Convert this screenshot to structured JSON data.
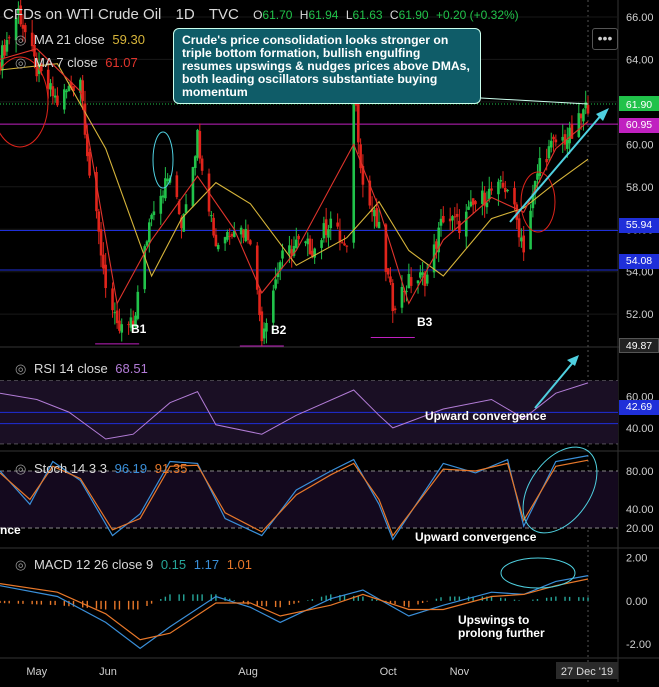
{
  "header": {
    "title": "CFDs on WTI Crude Oil",
    "interval": "1D",
    "source": "TVC",
    "o_label": "O",
    "o": "61.70",
    "h_label": "H",
    "h": "61.94",
    "l_label": "L",
    "l": "61.63",
    "c_label": "C",
    "c": "61.90",
    "change": "+0.20 (+0.32%)"
  },
  "indicators": {
    "ma21_label": "MA 21 close",
    "ma21_value": "59.30",
    "ma7_label": "MA 7 close",
    "ma7_value": "61.07",
    "rsi_label": "RSI 14 close",
    "rsi_value": "68.51",
    "stoch_label": "Stoch 14 3 3",
    "stoch_k": "96.19",
    "stoch_d": "91.35",
    "macd_label": "MACD 12 26 close 9",
    "macd_hist": "0.15",
    "macd_line": "1.17",
    "macd_signal": "1.01"
  },
  "menu_icon": "more-dots-icon",
  "callout": "Crude's price consolidation looks stronger on triple bottom formation, bullish engulfing resumes upswings & nudges prices above DMAs, both leading oscillators substantiate buying momentum",
  "annotations": {
    "b1": "B1",
    "b2": "B2",
    "b3": "B3",
    "rsi_note": "Upward convergence",
    "stoch_note": "Upward convergence",
    "stoch_cut": "nce",
    "macd_note": "Upswings to prolong further"
  },
  "price_badges": {
    "p6095": "60.95",
    "p5594": "55.94",
    "p5408": "54.08",
    "p4987": "49.87",
    "p4269": "42.69"
  },
  "colors": {
    "background": "#000000",
    "up": "#26a69a",
    "up_candle": "#21c24a",
    "down_candle": "#e0241b",
    "ma21": "#d6b43a",
    "ma7": "#e0342c",
    "rsi": "#b27cd6",
    "stoch_k": "#3a8fd9",
    "stoch_d": "#e8782a",
    "macd_line": "#3a8fd9",
    "macd_signal": "#e8782a",
    "hline_blue": "#1f2fd9",
    "hline_magenta": "#c020c0",
    "callout_bg": "#0f5c68",
    "annotation_cyan": "#4fd0e0",
    "current_price": "#21c24a"
  },
  "chart_data": [
    {
      "type": "candlestick",
      "title": "CFDs on WTI Crude Oil, 1D, TVC",
      "x_ticks": [
        "May",
        "Jun",
        "Aug",
        "Oct",
        "Nov",
        "27 Dec '19"
      ],
      "y_ticks": [
        52.0,
        54.0,
        56.0,
        58.0,
        60.0,
        62.0,
        64.0,
        66.0
      ],
      "ylim": [
        50.5,
        66.8
      ],
      "date_range": [
        "2019-04-15",
        "2019-12-27"
      ],
      "key_levels": [
        60.95,
        55.94,
        54.08
      ],
      "ohlc_last": {
        "open": 61.7,
        "high": 61.94,
        "low": 61.63,
        "close": 61.9
      },
      "close_path": [
        [
          "2019-04-15",
          64.0
        ],
        [
          "2019-04-23",
          66.3
        ],
        [
          "2019-05-01",
          63.5
        ],
        [
          "2019-05-10",
          62.0
        ],
        [
          "2019-05-20",
          63.2
        ],
        [
          "2019-05-24",
          58.6
        ],
        [
          "2019-05-31",
          53.5
        ],
        [
          "2019-06-05",
          51.2
        ],
        [
          "2019-06-12",
          51.5
        ],
        [
          "2019-06-20",
          57.0
        ],
        [
          "2019-06-28",
          58.5
        ],
        [
          "2019-07-03",
          56.3
        ],
        [
          "2019-07-10",
          60.4
        ],
        [
          "2019-07-18",
          55.3
        ],
        [
          "2019-07-26",
          56.2
        ],
        [
          "2019-08-02",
          55.7
        ],
        [
          "2019-08-07",
          51.1
        ],
        [
          "2019-08-15",
          54.5
        ],
        [
          "2019-08-22",
          55.3
        ],
        [
          "2019-08-30",
          55.1
        ],
        [
          "2019-09-06",
          56.5
        ],
        [
          "2019-09-13",
          54.8
        ],
        [
          "2019-09-16",
          62.9
        ],
        [
          "2019-09-20",
          58.1
        ],
        [
          "2019-09-27",
          55.9
        ],
        [
          "2019-10-03",
          52.5
        ],
        [
          "2019-10-10",
          53.5
        ],
        [
          "2019-10-18",
          53.8
        ],
        [
          "2019-10-25",
          56.6
        ],
        [
          "2019-11-01",
          56.2
        ],
        [
          "2019-11-08",
          57.2
        ],
        [
          "2019-11-15",
          57.8
        ],
        [
          "2019-11-22",
          58.0
        ],
        [
          "2019-11-29",
          55.2
        ],
        [
          "2019-12-06",
          59.2
        ],
        [
          "2019-12-13",
          60.1
        ],
        [
          "2019-12-20",
          60.4
        ],
        [
          "2019-12-27",
          61.9
        ]
      ],
      "ma21_path": [
        [
          "2019-04-15",
          63.5
        ],
        [
          "2019-05-10",
          63.8
        ],
        [
          "2019-05-31",
          59.8
        ],
        [
          "2019-06-20",
          53.8
        ],
        [
          "2019-07-03",
          56.5
        ],
        [
          "2019-07-18",
          58.2
        ],
        [
          "2019-08-02",
          57.2
        ],
        [
          "2019-08-22",
          54.3
        ],
        [
          "2019-09-13",
          55.6
        ],
        [
          "2019-09-27",
          57.3
        ],
        [
          "2019-10-10",
          55.0
        ],
        [
          "2019-10-25",
          53.8
        ],
        [
          "2019-11-15",
          56.5
        ],
        [
          "2019-11-29",
          57.0
        ],
        [
          "2019-12-13",
          58.2
        ],
        [
          "2019-12-27",
          59.3
        ]
      ],
      "ma7_path": [
        [
          "2019-04-15",
          64.0
        ],
        [
          "2019-05-01",
          64.5
        ],
        [
          "2019-05-20",
          62.5
        ],
        [
          "2019-06-05",
          52.5
        ],
        [
          "2019-06-20",
          55.5
        ],
        [
          "2019-07-10",
          58.5
        ],
        [
          "2019-07-26",
          56.0
        ],
        [
          "2019-08-07",
          53.0
        ],
        [
          "2019-08-22",
          55.0
        ],
        [
          "2019-09-16",
          60.0
        ],
        [
          "2019-09-27",
          57.0
        ],
        [
          "2019-10-10",
          52.5
        ],
        [
          "2019-10-25",
          55.5
        ],
        [
          "2019-11-15",
          57.5
        ],
        [
          "2019-11-29",
          56.8
        ],
        [
          "2019-12-13",
          59.8
        ],
        [
          "2019-12-27",
          61.07
        ]
      ],
      "bottoms": [
        {
          "label": "B1",
          "date": "2019-06-05",
          "price": 50.6
        },
        {
          "label": "B2",
          "date": "2019-08-07",
          "price": 50.5
        },
        {
          "label": "B3",
          "date": "2019-10-03",
          "price": 50.9
        }
      ]
    },
    {
      "type": "line",
      "title": "RSI 14 close",
      "y_ticks": [
        40.0,
        60.0
      ],
      "ylim": [
        26,
        90
      ],
      "levels": [
        70,
        30
      ],
      "key_levels": [
        49.87,
        42.69
      ],
      "series": [
        {
          "name": "RSI 14 close",
          "points": [
            [
              "2019-04-15",
              62
            ],
            [
              "2019-05-01",
              58
            ],
            [
              "2019-05-15",
              50
            ],
            [
              "2019-05-31",
              33
            ],
            [
              "2019-06-12",
              36
            ],
            [
              "2019-06-28",
              56
            ],
            [
              "2019-07-10",
              63
            ],
            [
              "2019-07-18",
              42
            ],
            [
              "2019-08-07",
              36
            ],
            [
              "2019-08-22",
              48
            ],
            [
              "2019-09-16",
              64
            ],
            [
              "2019-09-27",
              48
            ],
            [
              "2019-10-03",
              40
            ],
            [
              "2019-10-25",
              52
            ],
            [
              "2019-11-15",
              58
            ],
            [
              "2019-11-29",
              46
            ],
            [
              "2019-12-13",
              62
            ],
            [
              "2019-12-27",
              68.51
            ]
          ]
        }
      ]
    },
    {
      "type": "line",
      "title": "Stoch 14 3 3",
      "y_ticks": [
        20.0,
        40.0,
        80.0
      ],
      "ylim": [
        0,
        100
      ],
      "levels": [
        80,
        20
      ],
      "series": [
        {
          "name": "%K",
          "points": [
            [
              "2019-04-15",
              80
            ],
            [
              "2019-04-28",
              45
            ],
            [
              "2019-05-08",
              90
            ],
            [
              "2019-05-20",
              70
            ],
            [
              "2019-06-03",
              12
            ],
            [
              "2019-06-15",
              35
            ],
            [
              "2019-06-28",
              90
            ],
            [
              "2019-07-10",
              88
            ],
            [
              "2019-07-22",
              30
            ],
            [
              "2019-08-07",
              12
            ],
            [
              "2019-08-22",
              60
            ],
            [
              "2019-09-06",
              80
            ],
            [
              "2019-09-16",
              92
            ],
            [
              "2019-09-27",
              45
            ],
            [
              "2019-10-03",
              8
            ],
            [
              "2019-10-25",
              88
            ],
            [
              "2019-11-08",
              78
            ],
            [
              "2019-11-22",
              92
            ],
            [
              "2019-11-29",
              22
            ],
            [
              "2019-12-13",
              90
            ],
            [
              "2019-12-27",
              96.19
            ]
          ]
        },
        {
          "name": "%D",
          "points": [
            [
              "2019-04-15",
              78
            ],
            [
              "2019-04-28",
              50
            ],
            [
              "2019-05-08",
              85
            ],
            [
              "2019-05-20",
              72
            ],
            [
              "2019-06-03",
              18
            ],
            [
              "2019-06-15",
              30
            ],
            [
              "2019-06-28",
              85
            ],
            [
              "2019-07-10",
              86
            ],
            [
              "2019-07-22",
              36
            ],
            [
              "2019-08-07",
              16
            ],
            [
              "2019-08-22",
              55
            ],
            [
              "2019-09-06",
              76
            ],
            [
              "2019-09-16",
              88
            ],
            [
              "2019-09-27",
              50
            ],
            [
              "2019-10-03",
              12
            ],
            [
              "2019-10-25",
              82
            ],
            [
              "2019-11-08",
              80
            ],
            [
              "2019-11-22",
              88
            ],
            [
              "2019-11-29",
              28
            ],
            [
              "2019-12-13",
              85
            ],
            [
              "2019-12-27",
              91.35
            ]
          ]
        }
      ]
    },
    {
      "type": "line",
      "title": "MACD 12 26 close 9",
      "y_ticks": [
        -2.0,
        0.0,
        2.0
      ],
      "ylim": [
        -2.6,
        2.4
      ],
      "series": [
        {
          "name": "MACD",
          "points": [
            [
              "2019-04-15",
              0.7
            ],
            [
              "2019-05-10",
              0.2
            ],
            [
              "2019-05-31",
              -1.0
            ],
            [
              "2019-06-15",
              -2.2
            ],
            [
              "2019-06-28",
              -1.2
            ],
            [
              "2019-07-18",
              0.2
            ],
            [
              "2019-08-02",
              -0.3
            ],
            [
              "2019-08-15",
              -1.0
            ],
            [
              "2019-09-06",
              0.1
            ],
            [
              "2019-09-20",
              0.5
            ],
            [
              "2019-10-10",
              -0.7
            ],
            [
              "2019-10-25",
              -0.2
            ],
            [
              "2019-11-15",
              0.4
            ],
            [
              "2019-11-29",
              0.3
            ],
            [
              "2019-12-13",
              0.9
            ],
            [
              "2019-12-27",
              1.17
            ]
          ]
        },
        {
          "name": "Signal",
          "points": [
            [
              "2019-04-15",
              0.8
            ],
            [
              "2019-05-10",
              0.4
            ],
            [
              "2019-05-31",
              -0.6
            ],
            [
              "2019-06-15",
              -1.8
            ],
            [
              "2019-06-28",
              -1.5
            ],
            [
              "2019-07-18",
              -0.1
            ],
            [
              "2019-08-02",
              -0.1
            ],
            [
              "2019-08-15",
              -0.7
            ],
            [
              "2019-09-06",
              -0.2
            ],
            [
              "2019-09-20",
              0.3
            ],
            [
              "2019-10-10",
              -0.4
            ],
            [
              "2019-10-25",
              -0.4
            ],
            [
              "2019-11-15",
              0.2
            ],
            [
              "2019-11-29",
              0.3
            ],
            [
              "2019-12-13",
              0.7
            ],
            [
              "2019-12-27",
              1.01
            ]
          ]
        }
      ]
    }
  ]
}
